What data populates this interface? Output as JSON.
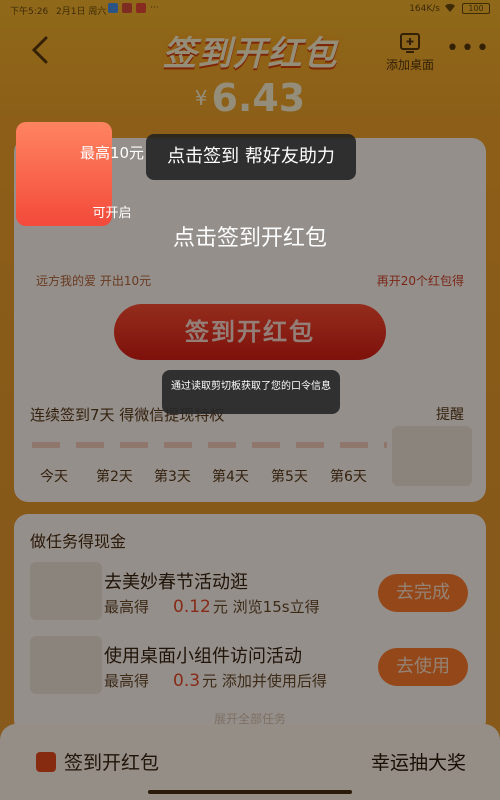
{
  "status_bar": {
    "time": "下午5:26",
    "date": "2月1日 周六",
    "more": "···",
    "network_speed": "164K/s",
    "battery": "100"
  },
  "header": {
    "title": "签到开红包",
    "add_desktop_label": "添加桌面",
    "more_glyph": "•••"
  },
  "balance": {
    "currency": "¥",
    "value": "6.43"
  },
  "main_card": {
    "badge_top": "最高10元",
    "badge_bottom": "可开启",
    "friend_opened": "远方我的爱  开出10元",
    "remaining": "再开20个红包得",
    "sign_button": "签到开红包",
    "streak_text": "连续签到7天 得微信提现特权",
    "remind_label": "提醒",
    "days": [
      "今天",
      "第2天",
      "第3天",
      "第4天",
      "第5天",
      "第6天"
    ]
  },
  "overlay": {
    "tip": "点击签到 帮好友助力",
    "title": "点击签到开红包",
    "toast": "通过读取剪切板获取了您的口令信息"
  },
  "tasks": {
    "heading": "做任务得现金",
    "items": [
      {
        "title": "去美妙春节活动逛",
        "prefix": "最高得",
        "money": "0.12",
        "unit": "元",
        "desc": "浏览15s立得",
        "button": "去完成"
      },
      {
        "title": "使用桌面小组件访问活动",
        "prefix": "最高得",
        "money": "0.3",
        "unit": "元",
        "desc": "添加并使用后得",
        "button": "去使用"
      }
    ],
    "view_all": "展开全部任务"
  },
  "bottom_bar": {
    "left_label": "签到开红包",
    "right_label": "幸运抽大奖"
  },
  "colors": {
    "background": "#f2a32a",
    "primary_red": "#e8321e",
    "task_button": "#ff7a2a"
  }
}
